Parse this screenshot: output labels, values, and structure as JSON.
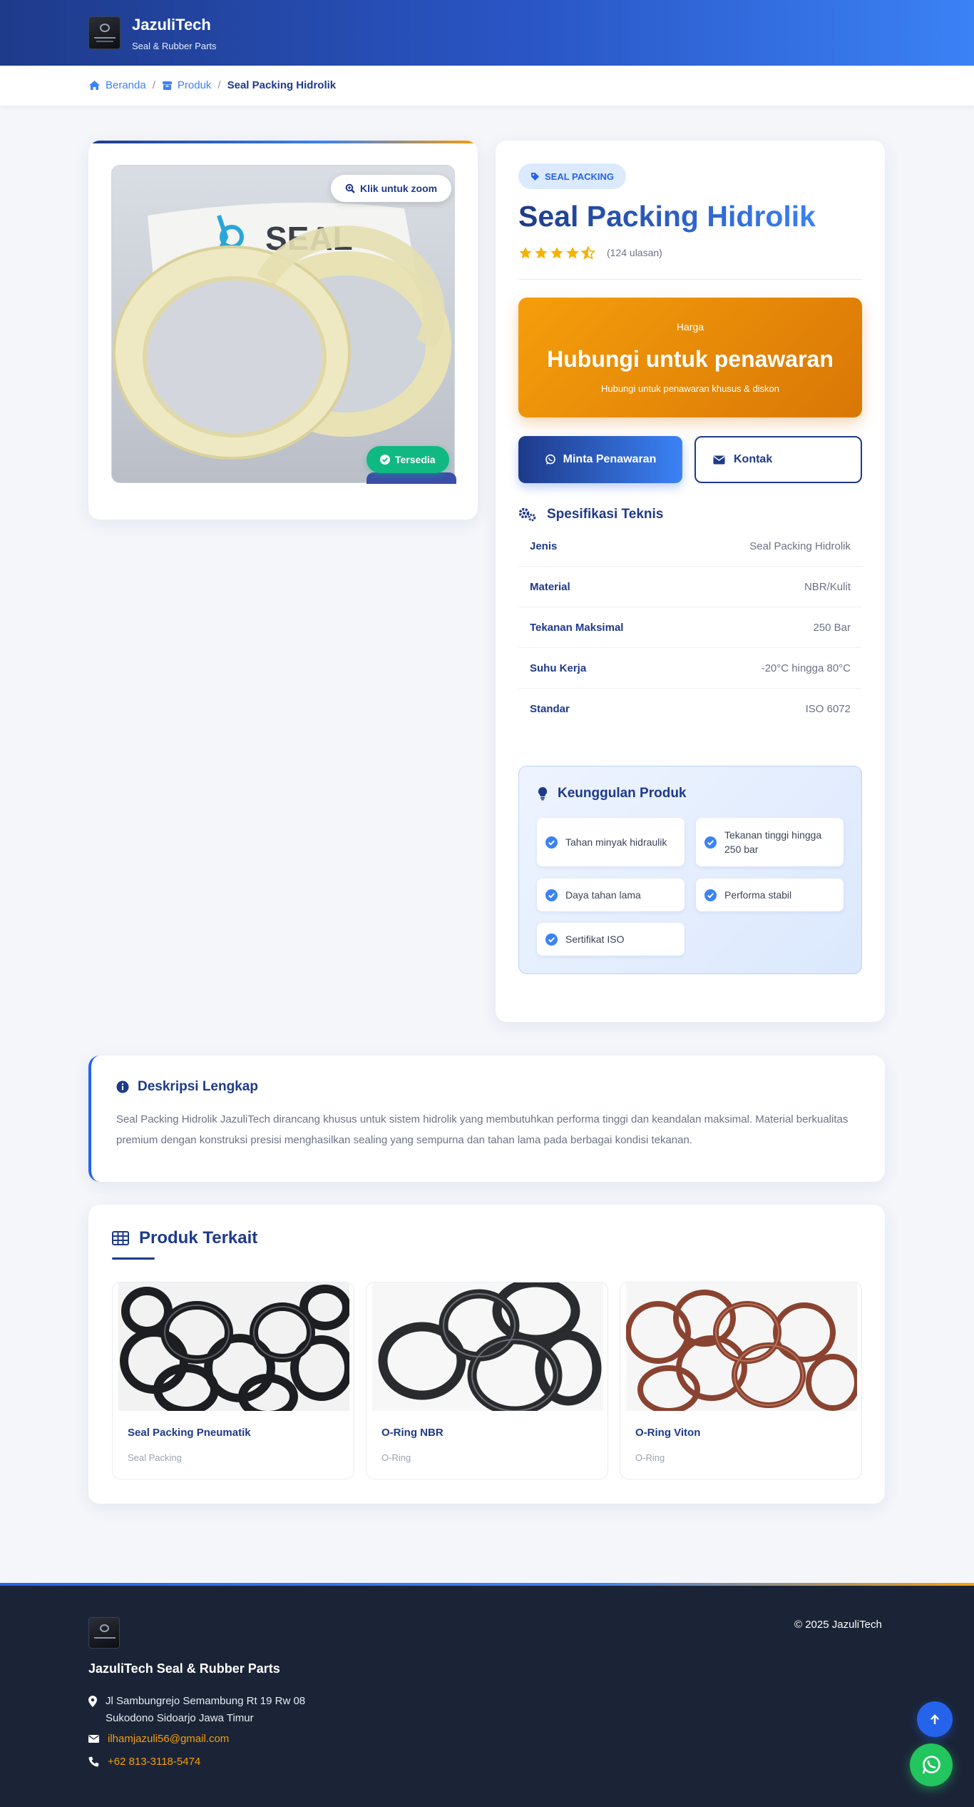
{
  "header": {
    "brand_title": "JazuliTech",
    "brand_subtitle": "Seal & Rubber Parts"
  },
  "breadcrumb": {
    "home": "Beranda",
    "products": "Produk",
    "current": "Seal Packing Hidrolik"
  },
  "gallery": {
    "zoom_label": "Klik untuk zoom",
    "availability": "Tersedia",
    "photo_brand_text": "SEAL"
  },
  "product": {
    "category_tag": "SEAL PACKING",
    "title": "Seal Packing Hidrolik",
    "rating": 4.5,
    "reviews": "(124 ulasan)",
    "price_label": "Harga",
    "price_value": "Hubungi untuk penawaran",
    "price_note": "Hubungi untuk penawaran khusus & diskon",
    "quote_button": "Minta Penawaran",
    "contact_button": "Kontak"
  },
  "specs": {
    "heading": "Spesifikasi Teknis",
    "rows": [
      {
        "key": "Jenis",
        "value": "Seal Packing Hidrolik"
      },
      {
        "key": "Material",
        "value": "NBR/Kulit"
      },
      {
        "key": "Tekanan Maksimal",
        "value": "250 Bar"
      },
      {
        "key": "Suhu Kerja",
        "value": "-20°C hingga 80°C"
      },
      {
        "key": "Standar",
        "value": "ISO 6072"
      }
    ]
  },
  "advantages": {
    "heading": "Keunggulan Produk",
    "items": [
      "Tahan minyak hidraulik",
      "Tekanan tinggi hingga 250 bar",
      "Daya tahan lama",
      "Performa stabil",
      "Sertifikat ISO"
    ]
  },
  "description": {
    "heading": "Deskripsi Lengkap",
    "text": "Seal Packing Hidrolik JazuliTech dirancang khusus untuk sistem hidrolik yang membutuhkan performa tinggi dan keandalan maksimal. Material berkualitas premium dengan konstruksi presisi menghasilkan sealing yang sempurna dan tahan lama pada berbagai kondisi tekanan."
  },
  "related": {
    "heading": "Produk Terkait",
    "items": [
      {
        "name": "Seal Packing Pneumatik",
        "category": "Seal Packing"
      },
      {
        "name": "O-Ring NBR",
        "category": "O-Ring"
      },
      {
        "name": "O-Ring Viton",
        "category": "O-Ring"
      }
    ]
  },
  "footer": {
    "brand": "JazuliTech Seal & Rubber Parts",
    "address_line1": "Jl Sambungrejo Semambung Rt 19 Rw 08",
    "address_line2": "Sukodono Sidoarjo Jawa Timur",
    "email": "ilhamjazuli56@gmail.com",
    "phone": "+62 813-3118-5474",
    "copyright": "© 2025 JazuliTech"
  },
  "colors": {
    "primary": "#1e3a8a",
    "accent": "#3b82f6",
    "price_orange": "#f59e0b",
    "success": "#10b981",
    "footer_bg": "#1b2437",
    "whatsapp": "#22c55e"
  }
}
